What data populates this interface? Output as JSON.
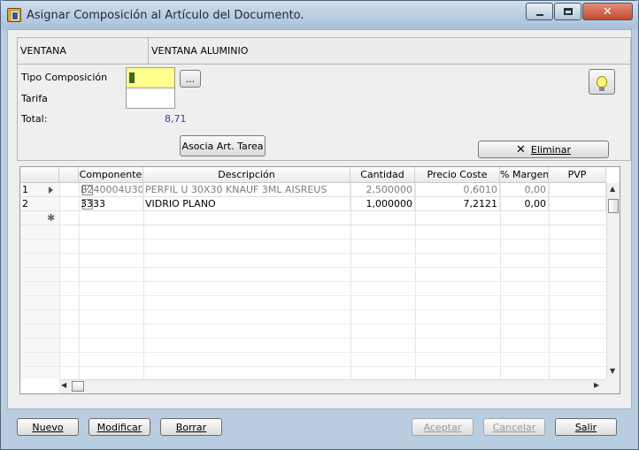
{
  "window": {
    "title": "Asignar Composición al Artículo del Documento."
  },
  "article": {
    "code": "VENTANA",
    "description": "VENTANA ALUMINIO"
  },
  "form": {
    "tipo_composicion_label": "Tipo Composición",
    "tipo_composicion_value": "1",
    "browse_label": "...",
    "tarifa_label": "Tarifa",
    "tarifa_value": "",
    "total_label": "Total:",
    "total_value": "8,71",
    "asocia_button": "Asocia Art. Tarea",
    "eliminar_button": "Eliminar"
  },
  "grid": {
    "columns": [
      "Componente",
      "Descripción",
      "Cantidad",
      "Precio Coste",
      "% Margen",
      "PVP"
    ],
    "rows": [
      {
        "num": "1",
        "checked": true,
        "componente": "B240004U30",
        "descripcion": "PERFIL U 30X30 KNAUF 3ML AISREUS",
        "cantidad": "2,500000",
        "precio_coste": "0,6010",
        "margen": "0,00",
        "pvp": ""
      },
      {
        "num": "2",
        "checked": false,
        "componente": "3333",
        "descripcion": "VIDRIO PLANO",
        "cantidad": "1,000000",
        "precio_coste": "7,2121",
        "margen": "0,00",
        "pvp": ""
      }
    ],
    "new_row_marker": "✱"
  },
  "footer": {
    "nuevo": "Nuevo",
    "modificar": "Modificar",
    "borrar": "Borrar",
    "aceptar": "Aceptar",
    "cancelar": "Cancelar",
    "salir": "Salir"
  },
  "icons": {
    "app": "document-app-icon",
    "minimize": "minimize-icon",
    "maximize": "maximize-icon",
    "close": "close-icon",
    "bulb": "lightbulb-icon",
    "delete": "delete-x-icon"
  }
}
